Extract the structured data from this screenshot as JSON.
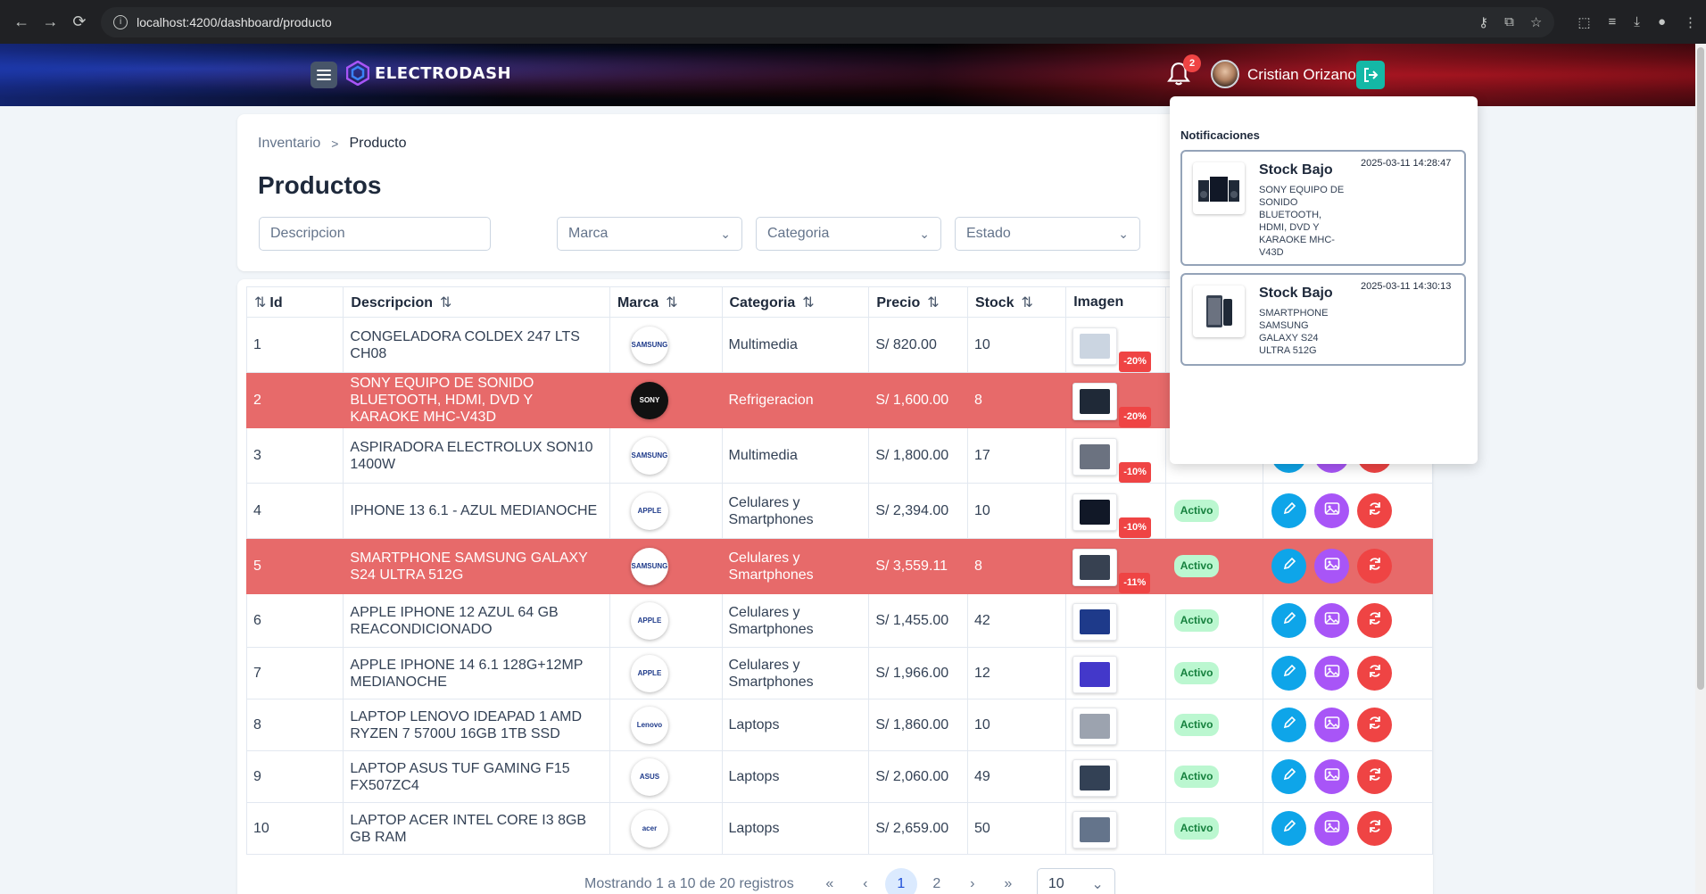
{
  "browser": {
    "url": "localhost:4200/dashboard/producto"
  },
  "header": {
    "logo_text": "ELECTRODASH",
    "notification_count": "2",
    "user_name": "Cristian Orizano"
  },
  "breadcrumb": {
    "parent": "Inventario",
    "current": "Producto"
  },
  "page_title": "Productos",
  "filters": {
    "descripcion_placeholder": "Descripcion",
    "marca_placeholder": "Marca",
    "categoria_placeholder": "Categoria",
    "estado_placeholder": "Estado"
  },
  "table": {
    "columns": [
      "Id",
      "Descripcion",
      "Marca",
      "Categoria",
      "Precio",
      "Stock",
      "Imagen"
    ],
    "rows": [
      {
        "id": "1",
        "descripcion": "CONGELADORA COLDEX 247 LTS CH08",
        "marca": "SAMSUNG",
        "categoria": "Multimedia",
        "precio": "S/ 820.00",
        "stock": "10",
        "descuento": "-20%",
        "estado": "",
        "low": false
      },
      {
        "id": "2",
        "descripcion": "SONY EQUIPO DE SONIDO BLUETOOTH, HDMI, DVD Y KARAOKE MHC-V43D",
        "marca": "SONY",
        "categoria": "Refrigeracion",
        "precio": "S/ 1,600.00",
        "stock": "8",
        "descuento": "-20%",
        "estado": "",
        "low": true
      },
      {
        "id": "3",
        "descripcion": "ASPIRADORA ELECTROLUX SON10 1400W",
        "marca": "SAMSUNG",
        "categoria": "Multimedia",
        "precio": "S/ 1,800.00",
        "stock": "17",
        "descuento": "-10%",
        "estado": "",
        "low": false
      },
      {
        "id": "4",
        "descripcion": "IPHONE 13 6.1 - AZUL MEDIANOCHE",
        "marca": "APPLE",
        "categoria": "Celulares y Smartphones",
        "precio": "S/ 2,394.00",
        "stock": "10",
        "descuento": "-10%",
        "estado": "Activo",
        "low": false
      },
      {
        "id": "5",
        "descripcion": "SMARTPHONE SAMSUNG GALAXY S24 ULTRA 512G",
        "marca": "SAMSUNG",
        "categoria": "Celulares y Smartphones",
        "precio": "S/ 3,559.11",
        "stock": "8",
        "descuento": "-11%",
        "estado": "Activo",
        "low": true
      },
      {
        "id": "6",
        "descripcion": "APPLE IPHONE 12 AZUL 64 GB REACONDICIONADO",
        "marca": "APPLE",
        "categoria": "Celulares y Smartphones",
        "precio": "S/ 1,455.00",
        "stock": "42",
        "descuento": "",
        "estado": "Activo",
        "low": false
      },
      {
        "id": "7",
        "descripcion": "APPLE IPHONE 14 6.1 128G+12MP MEDIANOCHE",
        "marca": "APPLE",
        "categoria": "Celulares y Smartphones",
        "precio": "S/ 1,966.00",
        "stock": "12",
        "descuento": "",
        "estado": "Activo",
        "low": false
      },
      {
        "id": "8",
        "descripcion": "LAPTOP LENOVO IDEAPAD 1 AMD RYZEN 7 5700U 16GB 1TB SSD",
        "marca": "Lenovo",
        "categoria": "Laptops",
        "precio": "S/ 1,860.00",
        "stock": "10",
        "descuento": "",
        "estado": "Activo",
        "low": false
      },
      {
        "id": "9",
        "descripcion": "LAPTOP ASUS TUF GAMING F15 FX507ZC4",
        "marca": "ASUS",
        "categoria": "Laptops",
        "precio": "S/ 2,060.00",
        "stock": "49",
        "descuento": "",
        "estado": "Activo",
        "low": false
      },
      {
        "id": "10",
        "descripcion": "LAPTOP ACER INTEL CORE I3 8GB GB RAM",
        "marca": "acer",
        "categoria": "Laptops",
        "precio": "S/ 2,659.00",
        "stock": "50",
        "descuento": "",
        "estado": "Activo",
        "low": false
      }
    ]
  },
  "pagination": {
    "summary": "Mostrando 1 a 10 de 20 registros",
    "first": "«",
    "prev": "‹",
    "page1": "1",
    "page2": "2",
    "next": "›",
    "last": "»",
    "rows_per_page": "10"
  },
  "notifications": {
    "title": "Notificaciones",
    "items": [
      {
        "title": "Stock Bajo",
        "date": "2025-03-11 14:28:47",
        "description": "SONY EQUIPO DE SONIDO BLUETOOTH, HDMI, DVD Y KARAOKE MHC-V43D"
      },
      {
        "title": "Stock Bajo",
        "date": "2025-03-11 14:30:13",
        "description": "SMARTPHONE SAMSUNG GALAXY S24 ULTRA 512G"
      }
    ]
  },
  "colors": {
    "low_stock_row": "#e76a6a",
    "edit": "#0ea5e9",
    "image": "#a855f7",
    "refresh": "#ef4444",
    "status_active": "#bbf7d0"
  }
}
